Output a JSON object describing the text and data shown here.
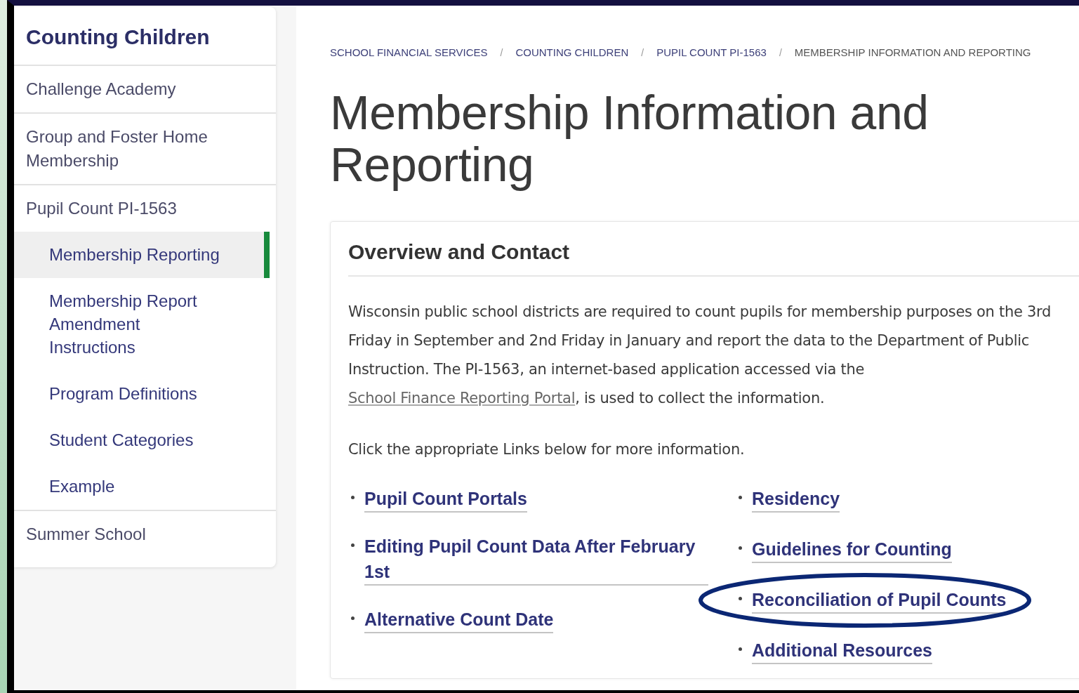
{
  "sidebar": {
    "title": "Counting Children",
    "items": [
      {
        "label": "Challenge Academy",
        "selected": false
      },
      {
        "label": "Group and Foster Home Membership",
        "selected": false
      },
      {
        "label": "Pupil Count PI-1563",
        "selected": false,
        "children": [
          {
            "label": "Membership Reporting",
            "selected": true
          },
          {
            "label": "Membership Report Amendment Instructions",
            "selected": false
          },
          {
            "label": "Program Definitions",
            "selected": false
          },
          {
            "label": "Student Categories",
            "selected": false
          },
          {
            "label": "Example",
            "selected": false
          }
        ]
      },
      {
        "label": "Summer School",
        "selected": false
      }
    ]
  },
  "breadcrumb": {
    "separator": "/",
    "items": [
      "SCHOOL FINANCIAL SERVICES",
      "COUNTING CHILDREN",
      "PUPIL COUNT PI-1563",
      "MEMBERSHIP INFORMATION AND REPORTING"
    ]
  },
  "page_title": "Membership Information and Reporting",
  "card": {
    "heading": "Overview and Contact",
    "intro": {
      "before": "Wisconsin public school districts are required to count pupils for membership purposes on the 3rd Friday in September and 2nd Friday in January and report the data to the Department of Public Instruction. The PI-1563, an internet-based application accessed via the",
      "link": "School Finance Reporting Portal",
      "after": ", is used to collect the information."
    },
    "note": "Click the appropriate Links below for more information.",
    "link_columns": [
      [
        {
          "label": "Pupil Count Portals",
          "circled": false
        },
        {
          "label": "Editing Pupil Count Data After February 1st",
          "circled": false
        },
        {
          "label": "Alternative Count Date",
          "circled": false
        }
      ],
      [
        {
          "label": "Residency",
          "circled": false
        },
        {
          "label": "Guidelines for Counting",
          "circled": false
        },
        {
          "label": "Reconciliation of Pupil Counts",
          "circled": true
        },
        {
          "label": "Additional Resources",
          "circled": false
        }
      ]
    ]
  }
}
